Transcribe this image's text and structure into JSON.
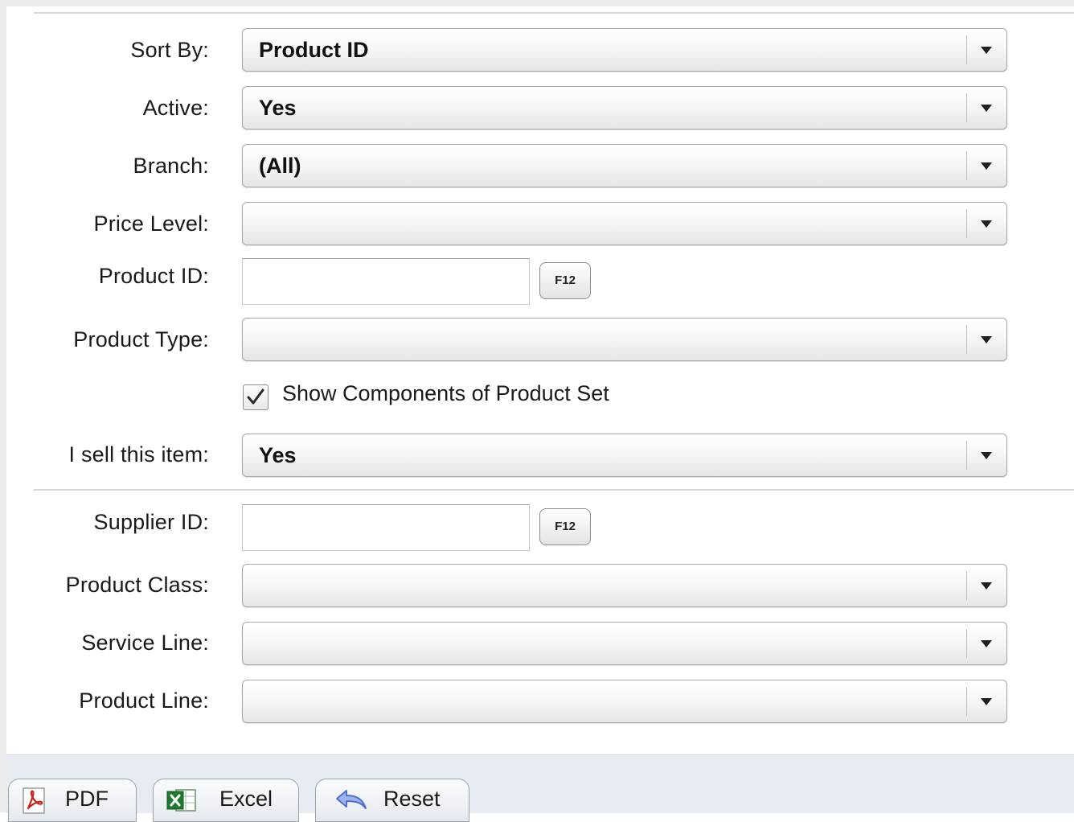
{
  "filters": {
    "sort_by": {
      "label": "Sort By:",
      "value": "Product ID"
    },
    "active": {
      "label": "Active:",
      "value": "Yes"
    },
    "branch": {
      "label": "Branch:",
      "value": "(All)"
    },
    "price_level": {
      "label": "Price Level:",
      "value": ""
    },
    "product_id": {
      "label": "Product ID:",
      "value": "",
      "lookup_label": "F12"
    },
    "product_type": {
      "label": "Product Type:",
      "value": ""
    },
    "show_components": {
      "label": "Show Components of Product Set",
      "checked": true
    },
    "sell_item": {
      "label": "I sell this item:",
      "value": "Yes"
    },
    "supplier_id": {
      "label": "Supplier ID:",
      "value": "",
      "lookup_label": "F12"
    },
    "product_class": {
      "label": "Product Class:",
      "value": ""
    },
    "service_line": {
      "label": "Service Line:",
      "value": ""
    },
    "product_line": {
      "label": "Product Line:",
      "value": ""
    }
  },
  "toolbar": {
    "pdf_label": "PDF",
    "excel_label": "Excel",
    "reset_label": "Reset"
  },
  "icons": {
    "dropdown": "chevron-down-icon",
    "pdf": "pdf-icon",
    "excel": "excel-icon",
    "reset": "undo-arrow-icon",
    "checkbox": "checkmark-icon"
  },
  "colors": {
    "toolbar_bg": "#e7ecf3",
    "select_border": "#a7a7a7",
    "pdf_red": "#c8221a",
    "excel_green": "#1e7a30",
    "reset_blue": "#4f6fcf"
  }
}
